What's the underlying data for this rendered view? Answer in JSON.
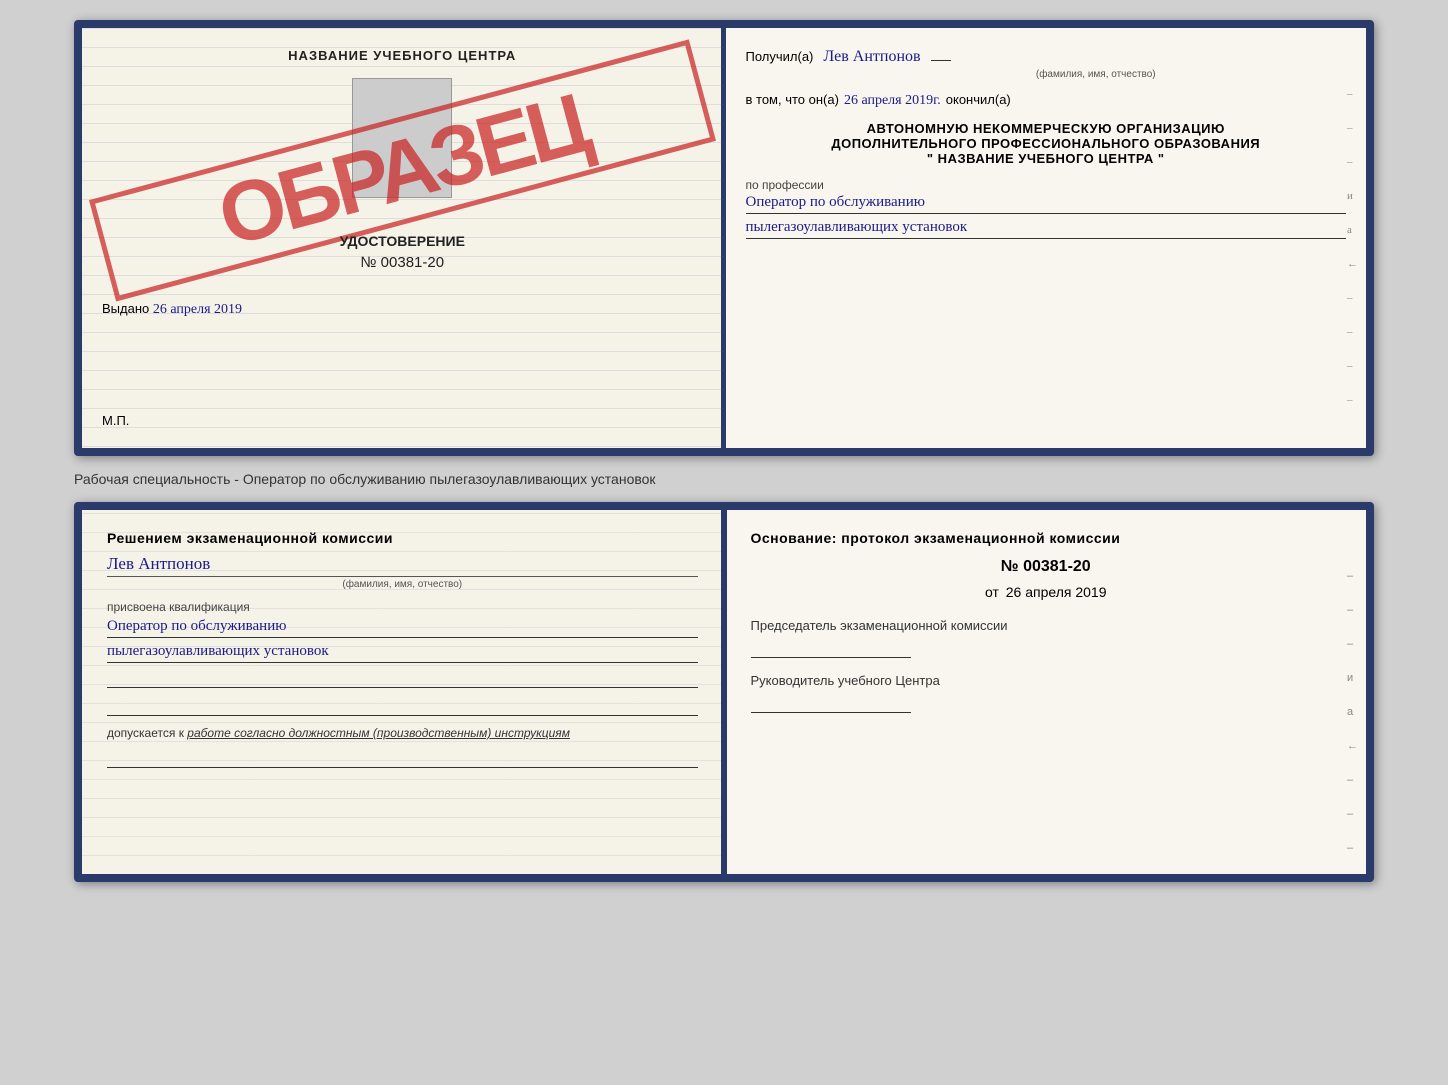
{
  "top_cert": {
    "left": {
      "title": "НАЗВАНИЕ УЧЕБНОГО ЦЕНТРА",
      "stamp": "ОБРАЗЕЦ",
      "cert_type": "УДОСТОВЕРЕНИЕ",
      "cert_number": "№ 00381-20",
      "issued_label": "Выдано",
      "issued_date": "26 апреля 2019",
      "mp_label": "М.П."
    },
    "right": {
      "received_label": "Получил(а)",
      "received_name": "Лев Антпонов",
      "fio_caption": "(фамилия, имя, отчество)",
      "in_that_label": "в том, что он(а)",
      "completed_date": "26 апреля 2019г.",
      "completed_label": "окончил(а)",
      "org_line1": "АВТОНОМНУЮ НЕКОММЕРЧЕСКУЮ ОРГАНИЗАЦИЮ",
      "org_line2": "ДОПОЛНИТЕЛЬНОГО ПРОФЕССИОНАЛЬНОГО ОБРАЗОВАНИЯ",
      "org_line3": "\"  НАЗВАНИЕ УЧЕБНОГО ЦЕНТРА  \"",
      "profession_label": "по профессии",
      "profession_line1": "Оператор по обслуживанию",
      "profession_line2": "пылегазоулавливающих установок"
    }
  },
  "separator": {
    "text": "Рабочая специальность - Оператор по обслуживанию пылегазоулавливающих установок"
  },
  "bottom_cert": {
    "left": {
      "decision_heading": "Решением экзаменационной комиссии",
      "person_name": "Лев Антпонов",
      "fio_caption": "(фамилия, имя, отчество)",
      "assigned_label": "присвоена квалификация",
      "qual_line1": "Оператор по обслуживанию",
      "qual_line2": "пылегазоулавливающих установок",
      "admitted_prefix": "допускается к",
      "admitted_text": "работе согласно должностным (производственным) инструкциям"
    },
    "right": {
      "basis_heading": "Основание: протокол экзаменационной комиссии",
      "protocol_number": "№ 00381-20",
      "protocol_date_prefix": "от",
      "protocol_date": "26 апреля 2019",
      "chairman_label": "Председатель экзаменационной комиссии",
      "director_label": "Руководитель учебного Центра"
    }
  }
}
